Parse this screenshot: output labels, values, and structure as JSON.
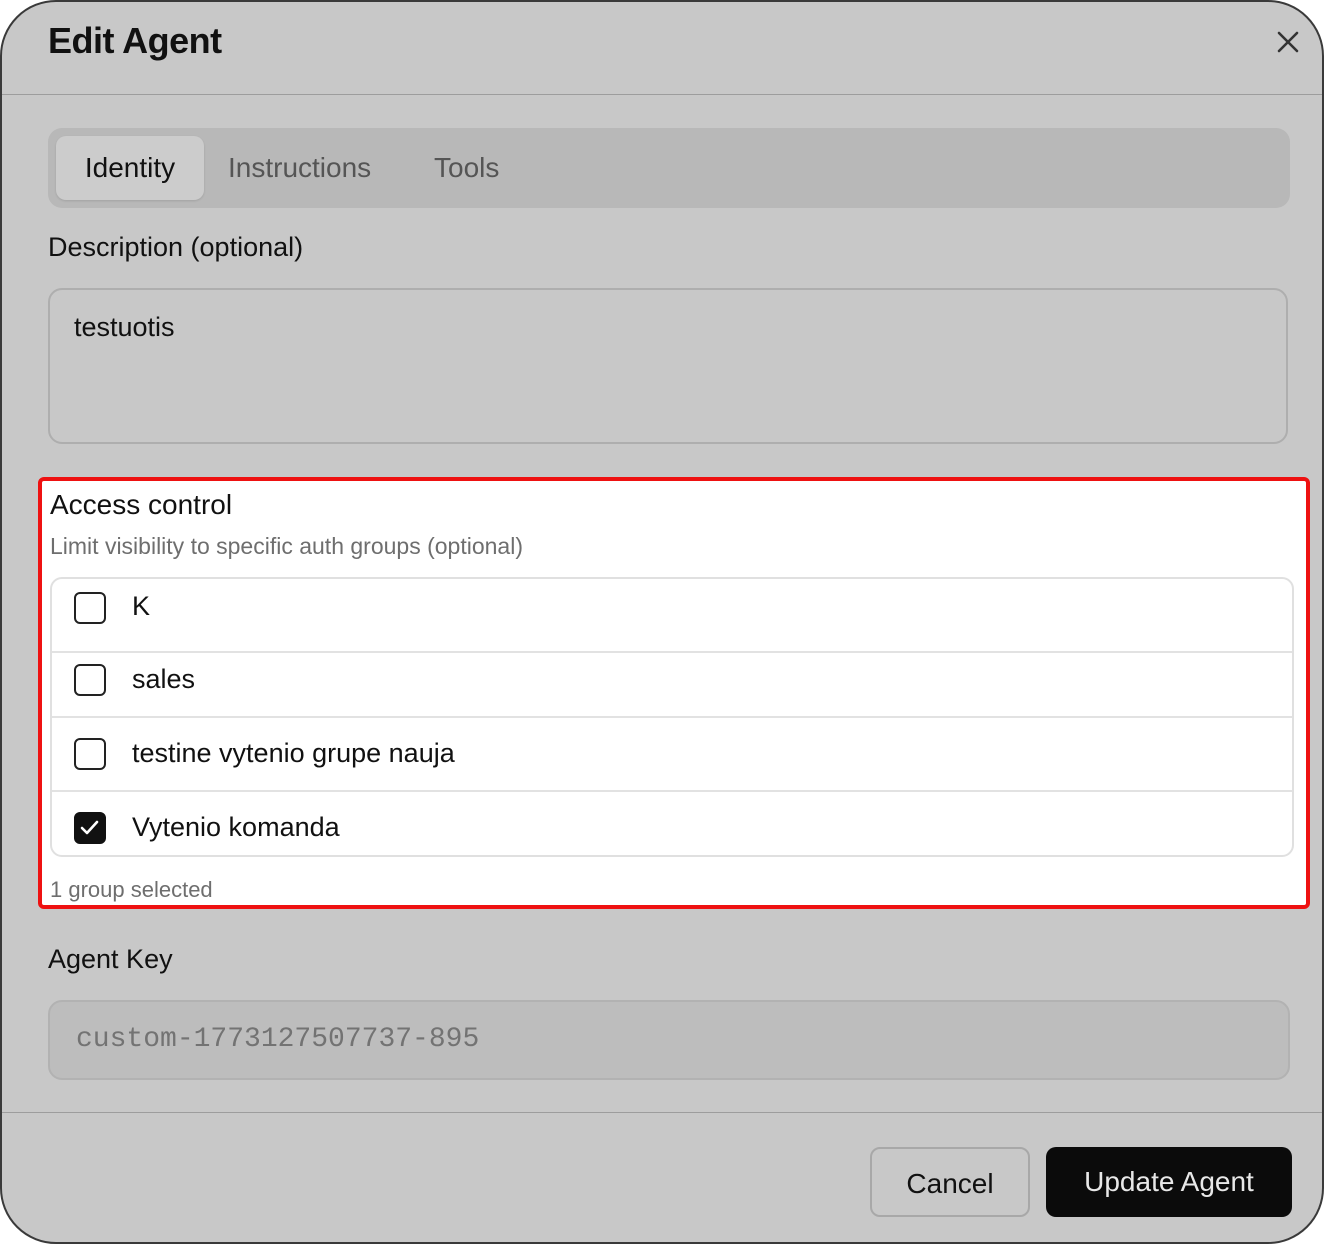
{
  "dialog": {
    "title": "Edit Agent",
    "close_icon": "close-icon"
  },
  "tabs": [
    {
      "label": "Identity",
      "active": true
    },
    {
      "label": "Instructions",
      "active": false
    },
    {
      "label": "Tools",
      "active": false
    }
  ],
  "description": {
    "label": "Description (optional)",
    "value": "testuotis"
  },
  "access_control": {
    "title": "Access control",
    "subtitle": "Limit visibility to specific auth groups (optional)",
    "groups": [
      {
        "label": "K",
        "checked": false
      },
      {
        "label": "sales",
        "checked": false
      },
      {
        "label": "testine vytenio grupe nauja",
        "checked": false
      },
      {
        "label": "Vytenio komanda",
        "checked": true
      }
    ],
    "selected_count_text": "1 group selected",
    "highlight_color": "#ee1111"
  },
  "agent_key": {
    "label": "Agent Key",
    "value": "custom-1773127507737-895"
  },
  "footer": {
    "cancel_label": "Cancel",
    "update_label": "Update Agent"
  }
}
